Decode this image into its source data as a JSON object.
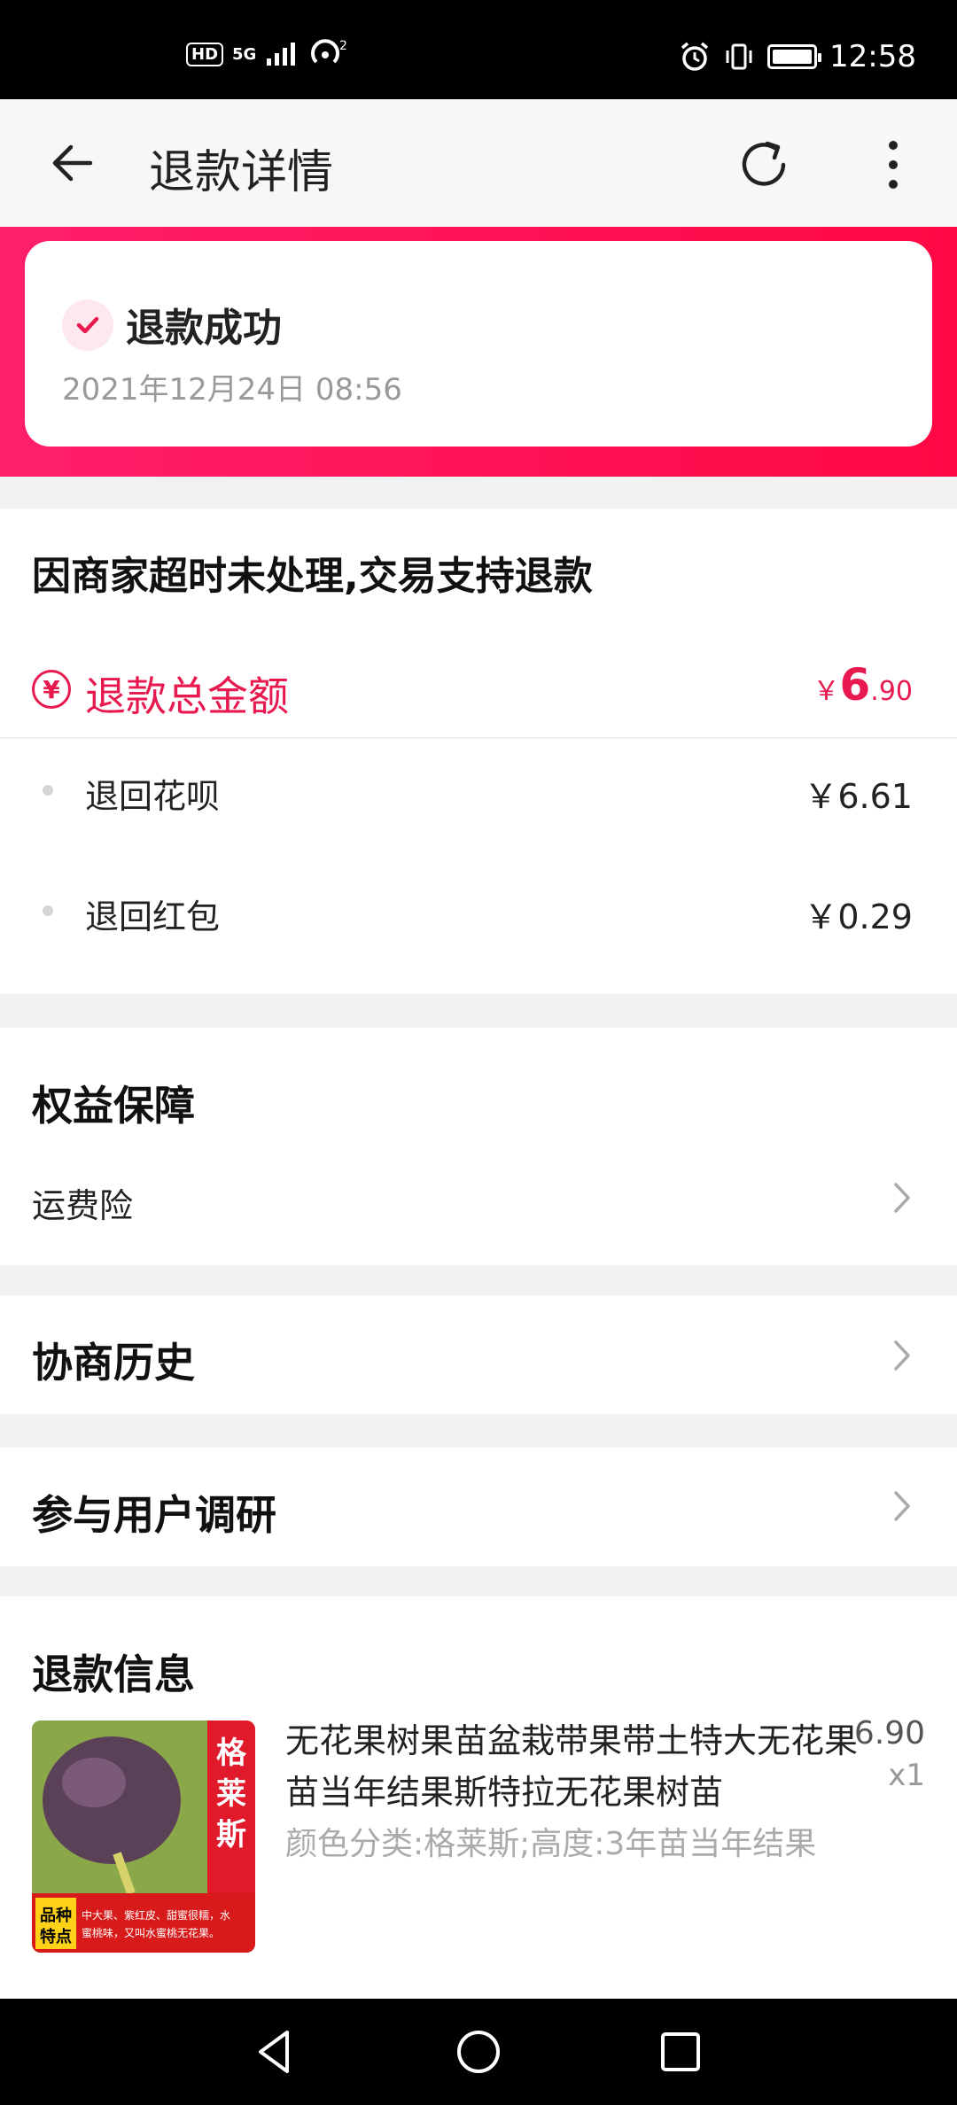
{
  "status_bar": {
    "left_icons": [
      "HD",
      "5G",
      "signal-icon",
      "hotspot-icon"
    ],
    "time": "12:58",
    "right_icons": [
      "alarm-icon",
      "vibrate-icon",
      "battery-icon"
    ]
  },
  "appbar": {
    "title": "退款详情"
  },
  "refund_status": {
    "title": "退款成功",
    "time": "2021年12月24日 08:56"
  },
  "summary": {
    "reason": "因商家超时未处理,交易支持退款",
    "total_label": "退款总金额",
    "total_symbol": "￥",
    "total_int": "6",
    "total_dec": ".90",
    "items": [
      {
        "label": "退回花呗",
        "value": "￥6.61"
      },
      {
        "label": "退回红包",
        "value": "￥0.29"
      }
    ]
  },
  "rights": {
    "title": "权益保障",
    "item": "运费险"
  },
  "negotiation": {
    "title": "协商历史"
  },
  "survey": {
    "title": "参与用户调研"
  },
  "refund_info": {
    "title": "退款信息",
    "product": {
      "name": "无花果树果苗盆栽带果带土特大无花果苗当年结果斯特拉无花果树苗",
      "sku": "颜色分类:格莱斯;高度:3年苗当年结果",
      "price": "6.90",
      "qty": "x1",
      "image_badge": "格莱斯",
      "image_tag": "品种特点",
      "image_desc": "中大果、紫红皮、甜蜜很糯，水蜜桃味，又叫水蜜桃无花果。"
    }
  },
  "colors": {
    "accent": "#e8194f",
    "hero_gradient": [
      "#ff1f6b",
      "#ff0844"
    ]
  }
}
